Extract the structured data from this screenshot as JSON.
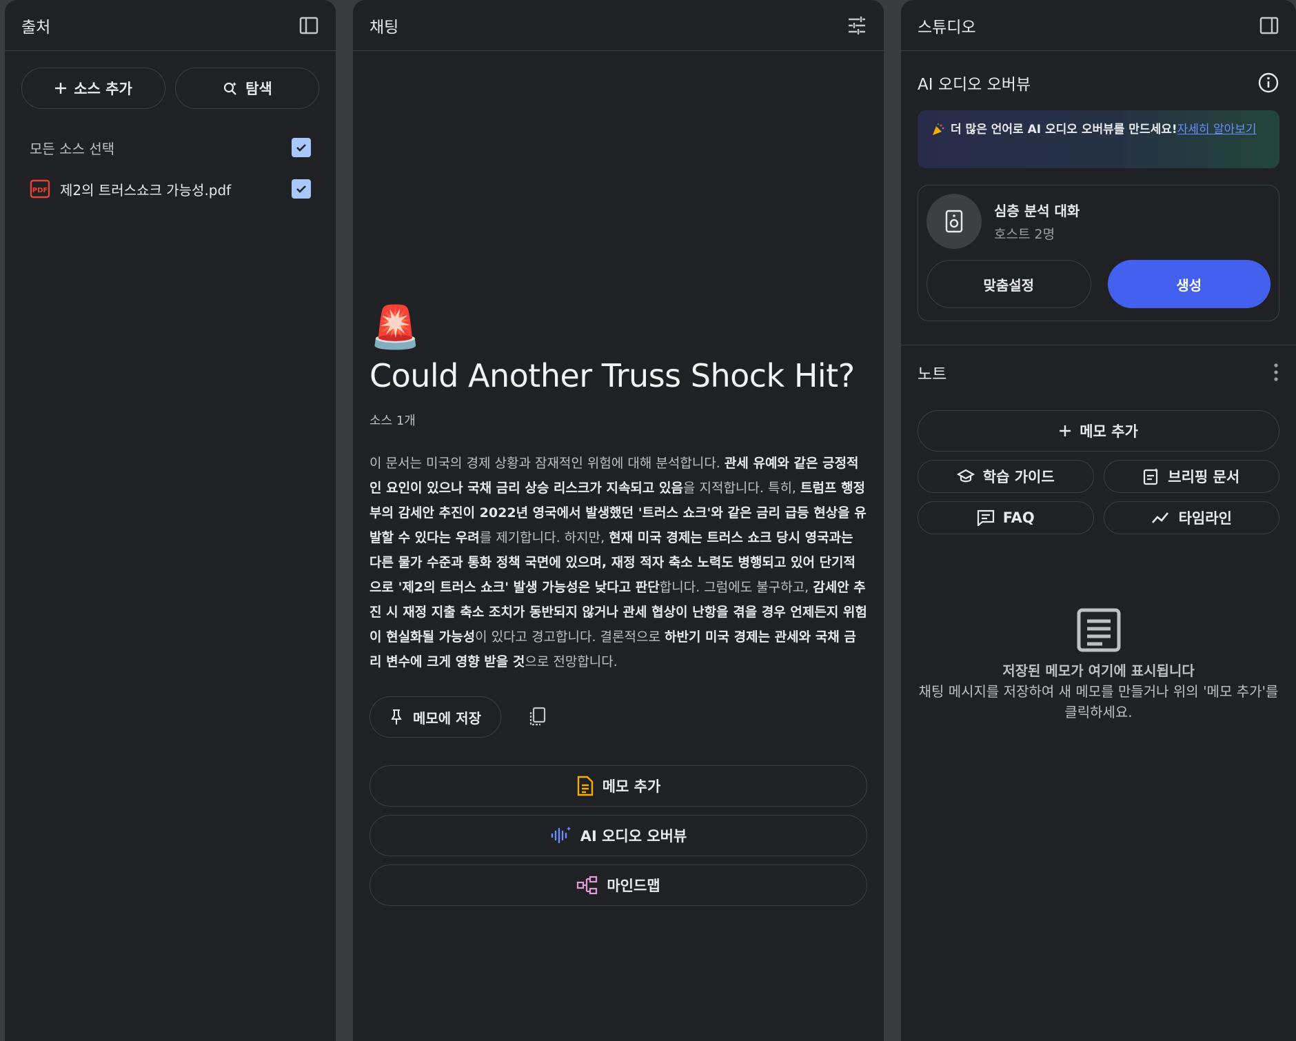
{
  "sources": {
    "title": "출처",
    "add_label": "소스 추가",
    "explore_label": "탐색",
    "select_all_label": "모든 소스 선택",
    "items": [
      {
        "name": "제2의 트러스쇼크 가능성.pdf",
        "type_badge": "PDF",
        "checked": true
      }
    ]
  },
  "chat": {
    "title": "채팅",
    "emoji": "🚨",
    "notebook_title": "Could Another Truss Shock Hit?",
    "source_count": "소스 1개",
    "summary_segments": [
      {
        "text": "이 문서는 미국의 경제 상황과 잠재적인 위험에 대해 분석합니다. ",
        "bold": false
      },
      {
        "text": "관세 유예와 같은 긍정적인 요인이 있으나 국채 금리 상승 리스크가 지속되고 있음",
        "bold": true
      },
      {
        "text": "을 지적합니다. 특히, ",
        "bold": false
      },
      {
        "text": "트럼프 행정부의 감세안 추진이 2022년 영국에서 발생했던 '트러스 쇼크'와 같은 금리 급등 현상을 유발할 수 있다는 우려",
        "bold": true
      },
      {
        "text": "를 제기합니다. 하지만, ",
        "bold": false
      },
      {
        "text": "현재 미국 경제는 트러스 쇼크 당시 영국과는 다른 물가 수준과 통화 정책 국면에 있으며, 재정 적자 축소 노력도 병행되고 있어 단기적으로 '제2의 트러스 쇼크' 발생 가능성은 낮다고 판단",
        "bold": true
      },
      {
        "text": "합니다. 그럼에도 불구하고, ",
        "bold": false
      },
      {
        "text": "감세안 추진 시 재정 지출 축소 조치가 동반되지 않거나 관세 협상이 난항을 겪을 경우 언제든지 위험이 현실화될 가능성",
        "bold": true
      },
      {
        "text": "이 있다고 경고합니다. 결론적으로 ",
        "bold": false
      },
      {
        "text": "하반기 미국 경제는 관세와 국채 금리 변수에 크게 영향 받을 것",
        "bold": true
      },
      {
        "text": "으로 전망합니다.",
        "bold": false
      }
    ],
    "save_to_note_label": "메모에 저장",
    "add_note_label": "메모 추가",
    "audio_overview_label": "AI 오디오 오버뷰",
    "mindmap_label": "마인드맵"
  },
  "studio": {
    "title": "스튜디오",
    "audio_section_title": "AI 오디오 오버뷰",
    "banner_text": "더 많은 언어로 AI 오디오 오버뷰를 만드세요!",
    "banner_link": "자세히 알아보기",
    "audio_card_title": "심층 분석 대화",
    "audio_card_subtitle": "호스트 2명",
    "customize_label": "맞춤설정",
    "generate_label": "생성",
    "notes_title": "노트",
    "add_memo_label": "메모 추가",
    "tools": [
      {
        "label": "학습 가이드",
        "icon": "graduation-cap-icon"
      },
      {
        "label": "브리핑 문서",
        "icon": "briefing-doc-icon"
      },
      {
        "label": "FAQ",
        "icon": "faq-icon"
      },
      {
        "label": "타임라인",
        "icon": "timeline-icon"
      }
    ],
    "empty_title": "저장된 메모가 여기에 표시됩니다",
    "empty_desc": "채팅 메시지를 저장하여 새 메모를 만들거나 위의 '메모 추가'를 클릭하세요."
  },
  "colors": {
    "background": "#202124",
    "accent_blue": "#4361ee",
    "checkbox": "#a8c7fa",
    "pdf_red": "#ea4335"
  }
}
